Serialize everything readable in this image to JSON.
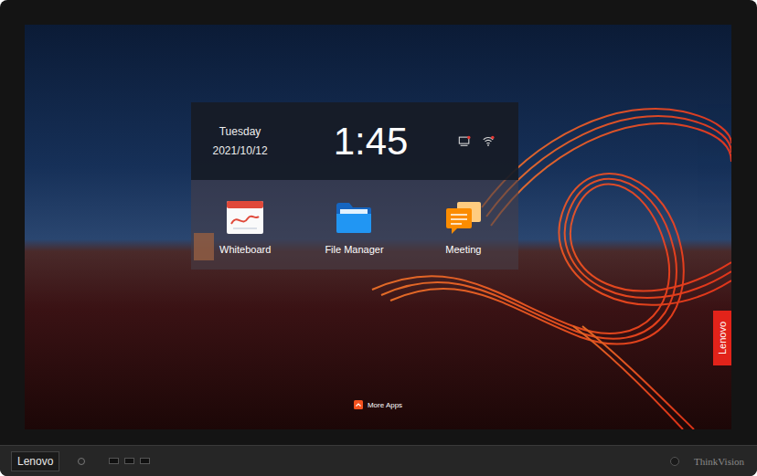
{
  "clock": {
    "day": "Tuesday",
    "date": "2021/10/12",
    "time": "1:45"
  },
  "apps": [
    {
      "label": "Whiteboard",
      "kind": "whiteboard"
    },
    {
      "label": "File Manager",
      "kind": "folder"
    },
    {
      "label": "Meeting",
      "kind": "meeting"
    }
  ],
  "more_apps": {
    "label": "More Apps"
  },
  "side_tag": {
    "label": "Lenovo"
  },
  "bezel": {
    "brand": "Lenovo",
    "model": "ThinkVision"
  }
}
